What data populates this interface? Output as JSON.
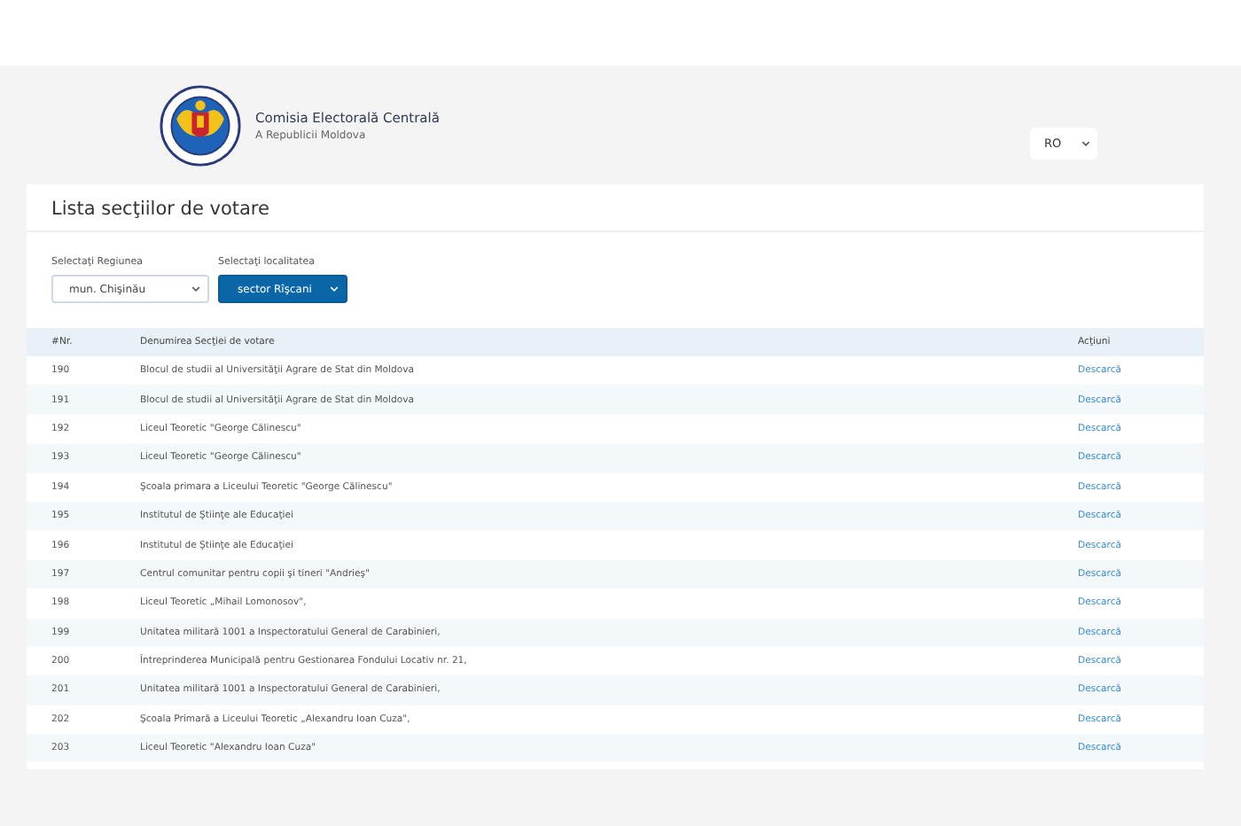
{
  "header": {
    "title": "Comisia Electorală Centrală",
    "subtitle": "A Republicii Moldova",
    "language": "RO"
  },
  "card": {
    "title": "Lista secţiilor de votare"
  },
  "filters": [
    {
      "label": "Selectaţi Regiunea",
      "value": "mun. Chişinău",
      "kind": "plain"
    },
    {
      "label": "Selectaţi localitatea",
      "value": "sector Rîşcani",
      "kind": "primary"
    }
  ],
  "table": {
    "columns": [
      "#Nr.",
      "Denumirea Secţiei de votare",
      "Acţiuni"
    ],
    "rows": [
      {
        "number": "190",
        "name": "Blocul de studii al Universităţii Agrare de Stat din Moldova",
        "action": "Descarcă"
      },
      {
        "number": "191",
        "name": "Blocul de studii al Universităţii Agrare de Stat din Moldova",
        "action": "Descarcă"
      },
      {
        "number": "192",
        "name": "Liceul Teoretic \"George Călinescu\"",
        "action": "Descarcă"
      },
      {
        "number": "193",
        "name": "Liceul Teoretic \"George Călinescu\"",
        "action": "Descarcă"
      },
      {
        "number": "194",
        "name": "Şcoala primara a Liceului Teoretic \"George Călinescu\"",
        "action": "Descarcă"
      },
      {
        "number": "195",
        "name": "Institutul de Ştiinţe ale Educaţiei",
        "action": "Descarcă"
      },
      {
        "number": "196",
        "name": "Institutul de Ştiinţe ale Educaţiei",
        "action": "Descarcă"
      },
      {
        "number": "197",
        "name": "Centrul comunitar pentru copii şi tineri \"Andrieş\"",
        "action": "Descarcă"
      },
      {
        "number": "198",
        "name": "Liceul Teoretic „Mihail Lomonosov\",",
        "action": "Descarcă"
      },
      {
        "number": "199",
        "name": "Unitatea militară 1001 a Inspectoratului General de Carabinieri,",
        "action": "Descarcă"
      },
      {
        "number": "200",
        "name": "Întreprinderea Municipală pentru Gestionarea Fondului Locativ nr. 21,",
        "action": "Descarcă"
      },
      {
        "number": "201",
        "name": "Unitatea militară 1001 a Inspectoratului General de Carabinieri,",
        "action": "Descarcă"
      },
      {
        "number": "202",
        "name": "Şcoala Primară a Liceului Teoretic „Alexandru Ioan Cuza\",",
        "action": "Descarcă"
      },
      {
        "number": "203",
        "name": "Liceul Teoretic \"Alexandru Ioan Cuza\"",
        "action": "Descarcă"
      }
    ]
  }
}
